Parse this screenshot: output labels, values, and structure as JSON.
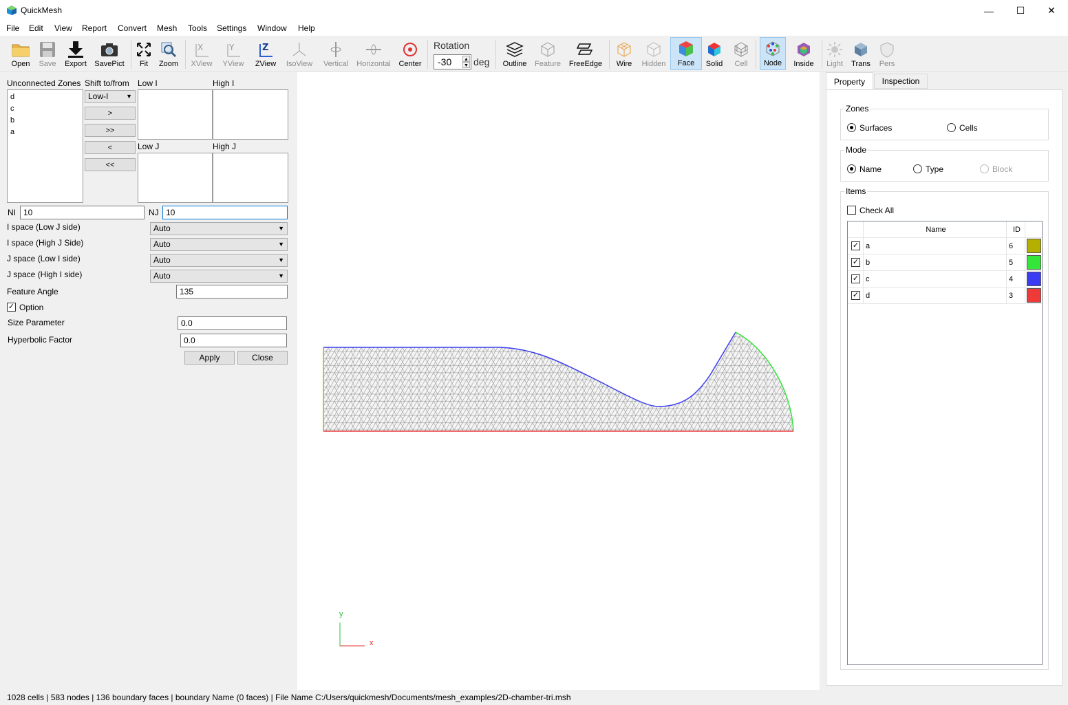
{
  "app": {
    "title": "QuickMesh"
  },
  "window_controls": {
    "minimize": "—",
    "maximize": "☐",
    "close": "✕"
  },
  "menu": [
    "File",
    "Edit",
    "View",
    "Report",
    "Convert",
    "Mesh",
    "Tools",
    "Settings",
    "Window",
    "Help"
  ],
  "toolbar": {
    "open": "Open",
    "save": "Save",
    "export": "Export",
    "savepict": "SavePict",
    "fit": "Fit",
    "zoom": "Zoom",
    "xview": "XView",
    "yview": "YView",
    "zview": "ZView",
    "isoview": "IsoView",
    "vertical": "Vertical",
    "horizontal": "Horizontal",
    "center": "Center",
    "rotation_label": "Rotation",
    "rotation_value": "-30",
    "rotation_unit": "deg",
    "outline": "Outline",
    "feature": "Feature",
    "freeedge": "FreeEdge",
    "wire": "Wire",
    "hidden": "Hidden",
    "face": "Face",
    "solid": "Solid",
    "cell": "Cell",
    "node": "Node",
    "inside": "Inside",
    "light": "Light",
    "trans": "Trans",
    "pers": "Pers"
  },
  "left_panel": {
    "unconnected_label": "Unconnected Zones",
    "shift_label": "Shift to/from",
    "zones": [
      "d",
      "c",
      "b",
      "a"
    ],
    "target_combo": "Low-I",
    "move_buttons": [
      ">",
      ">>",
      "<",
      "<<"
    ],
    "low_i": "Low I",
    "high_i": "High I",
    "low_j": "Low J",
    "high_j": "High J",
    "ni_label": "NI",
    "ni_value": "10",
    "nj_label": "NJ",
    "nj_value": "10",
    "spacing": [
      {
        "label": "I space (Low J side)",
        "value": "Auto"
      },
      {
        "label": "I space (High J Side)",
        "value": "Auto"
      },
      {
        "label": "J space (Low I side)",
        "value": "Auto"
      },
      {
        "label": "J space (High I side)",
        "value": "Auto"
      }
    ],
    "feature_angle_label": "Feature Angle",
    "feature_angle_value": "135",
    "option_label": "Option",
    "option_checked": true,
    "size_param_label": "Size Parameter",
    "size_param_value": "0.0",
    "hyperbolic_label": "Hyperbolic Factor",
    "hyperbolic_value": "0.0",
    "apply": "Apply",
    "close": "Close"
  },
  "viewport": {
    "axis_y": "y",
    "axis_x": "x"
  },
  "right_panel": {
    "tabs": [
      "Property",
      "Inspection"
    ],
    "zones_title": "Zones",
    "zones_options": [
      "Surfaces",
      "Cells"
    ],
    "zones_selected": "Surfaces",
    "mode_title": "Mode",
    "mode_options": [
      "Name",
      "Type",
      "Block"
    ],
    "mode_selected": "Name",
    "items_title": "Items",
    "check_all": "Check All",
    "table_headers": {
      "name": "Name",
      "id": "ID"
    },
    "rows": [
      {
        "name": "a",
        "id": "6",
        "color": "#b5b000",
        "checked": true
      },
      {
        "name": "b",
        "id": "5",
        "color": "#33e639",
        "checked": true
      },
      {
        "name": "c",
        "id": "4",
        "color": "#3b3df2",
        "checked": true
      },
      {
        "name": "d",
        "id": "3",
        "color": "#ef3a3a",
        "checked": true
      }
    ]
  },
  "status": "1028 cells | 583 nodes | 136 boundary faces |  boundary Name  (0 faces) | File Name C:/Users/quickmesh/Documents/mesh_examples/2D-chamber-tri.msh",
  "colors": {
    "accent": "#0078d7",
    "mesh_line": "#8c8c8c",
    "zone_a": "#b5b000",
    "zone_b": "#33e639",
    "zone_c": "#3b3df2",
    "zone_d": "#ef3a3a"
  }
}
